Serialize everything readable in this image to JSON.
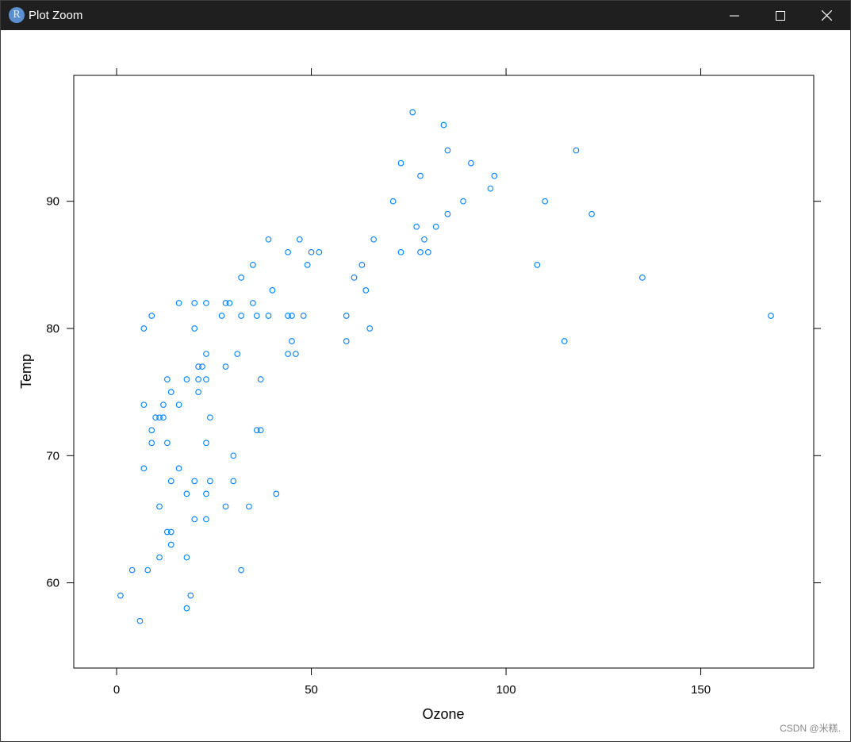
{
  "window": {
    "title": "Plot Zoom",
    "app_icon_letter": "R",
    "controls": {
      "minimize": "minimize",
      "maximize": "maximize",
      "close": "close"
    }
  },
  "watermark": "CSDN @米糕.",
  "chart_data": {
    "type": "scatter",
    "xlabel": "Ozone",
    "ylabel": "Temp",
    "xlim": [
      -11,
      179
    ],
    "ylim": [
      53.3,
      99.9
    ],
    "x_ticks": [
      0,
      50,
      100,
      150
    ],
    "y_ticks": [
      60,
      70,
      80,
      90
    ],
    "grid": false,
    "marker": {
      "shape": "open-circle",
      "color": "#0080ff"
    },
    "points": [
      {
        "x": 1,
        "y": 59
      },
      {
        "x": 4,
        "y": 61
      },
      {
        "x": 6,
        "y": 57
      },
      {
        "x": 7,
        "y": 80
      },
      {
        "x": 7,
        "y": 74
      },
      {
        "x": 7,
        "y": 69
      },
      {
        "x": 8,
        "y": 61
      },
      {
        "x": 9,
        "y": 81
      },
      {
        "x": 9,
        "y": 72
      },
      {
        "x": 9,
        "y": 71
      },
      {
        "x": 10,
        "y": 73
      },
      {
        "x": 11,
        "y": 73
      },
      {
        "x": 11,
        "y": 66
      },
      {
        "x": 11,
        "y": 62
      },
      {
        "x": 12,
        "y": 74
      },
      {
        "x": 12,
        "y": 73
      },
      {
        "x": 13,
        "y": 76
      },
      {
        "x": 13,
        "y": 71
      },
      {
        "x": 13,
        "y": 64
      },
      {
        "x": 14,
        "y": 75
      },
      {
        "x": 14,
        "y": 68
      },
      {
        "x": 14,
        "y": 64
      },
      {
        "x": 14,
        "y": 63
      },
      {
        "x": 16,
        "y": 82
      },
      {
        "x": 16,
        "y": 74
      },
      {
        "x": 16,
        "y": 69
      },
      {
        "x": 18,
        "y": 76
      },
      {
        "x": 18,
        "y": 67
      },
      {
        "x": 18,
        "y": 62
      },
      {
        "x": 18,
        "y": 58
      },
      {
        "x": 19,
        "y": 59
      },
      {
        "x": 20,
        "y": 82
      },
      {
        "x": 20,
        "y": 80
      },
      {
        "x": 20,
        "y": 68
      },
      {
        "x": 20,
        "y": 65
      },
      {
        "x": 21,
        "y": 77
      },
      {
        "x": 21,
        "y": 76
      },
      {
        "x": 21,
        "y": 75
      },
      {
        "x": 22,
        "y": 77
      },
      {
        "x": 23,
        "y": 82
      },
      {
        "x": 23,
        "y": 78
      },
      {
        "x": 23,
        "y": 76
      },
      {
        "x": 23,
        "y": 71
      },
      {
        "x": 23,
        "y": 67
      },
      {
        "x": 23,
        "y": 65
      },
      {
        "x": 24,
        "y": 73
      },
      {
        "x": 24,
        "y": 68
      },
      {
        "x": 27,
        "y": 81
      },
      {
        "x": 28,
        "y": 82
      },
      {
        "x": 28,
        "y": 77
      },
      {
        "x": 28,
        "y": 66
      },
      {
        "x": 29,
        "y": 82
      },
      {
        "x": 30,
        "y": 70
      },
      {
        "x": 30,
        "y": 68
      },
      {
        "x": 31,
        "y": 78
      },
      {
        "x": 32,
        "y": 84
      },
      {
        "x": 32,
        "y": 81
      },
      {
        "x": 32,
        "y": 61
      },
      {
        "x": 34,
        "y": 66
      },
      {
        "x": 35,
        "y": 85
      },
      {
        "x": 35,
        "y": 82
      },
      {
        "x": 36,
        "y": 81
      },
      {
        "x": 36,
        "y": 72
      },
      {
        "x": 37,
        "y": 76
      },
      {
        "x": 37,
        "y": 72
      },
      {
        "x": 39,
        "y": 87
      },
      {
        "x": 39,
        "y": 81
      },
      {
        "x": 40,
        "y": 83
      },
      {
        "x": 41,
        "y": 67
      },
      {
        "x": 44,
        "y": 86
      },
      {
        "x": 44,
        "y": 81
      },
      {
        "x": 44,
        "y": 78
      },
      {
        "x": 45,
        "y": 81
      },
      {
        "x": 45,
        "y": 79
      },
      {
        "x": 46,
        "y": 78
      },
      {
        "x": 47,
        "y": 87
      },
      {
        "x": 48,
        "y": 81
      },
      {
        "x": 49,
        "y": 85
      },
      {
        "x": 50,
        "y": 86
      },
      {
        "x": 52,
        "y": 86
      },
      {
        "x": 59,
        "y": 81
      },
      {
        "x": 59,
        "y": 79
      },
      {
        "x": 61,
        "y": 84
      },
      {
        "x": 63,
        "y": 85
      },
      {
        "x": 64,
        "y": 83
      },
      {
        "x": 65,
        "y": 80
      },
      {
        "x": 66,
        "y": 87
      },
      {
        "x": 71,
        "y": 90
      },
      {
        "x": 73,
        "y": 93
      },
      {
        "x": 73,
        "y": 86
      },
      {
        "x": 76,
        "y": 97
      },
      {
        "x": 77,
        "y": 88
      },
      {
        "x": 78,
        "y": 92
      },
      {
        "x": 78,
        "y": 86
      },
      {
        "x": 79,
        "y": 87
      },
      {
        "x": 80,
        "y": 86
      },
      {
        "x": 82,
        "y": 88
      },
      {
        "x": 84,
        "y": 96
      },
      {
        "x": 85,
        "y": 94
      },
      {
        "x": 85,
        "y": 89
      },
      {
        "x": 89,
        "y": 90
      },
      {
        "x": 91,
        "y": 93
      },
      {
        "x": 96,
        "y": 91
      },
      {
        "x": 97,
        "y": 92
      },
      {
        "x": 108,
        "y": 85
      },
      {
        "x": 110,
        "y": 90
      },
      {
        "x": 115,
        "y": 79
      },
      {
        "x": 118,
        "y": 94
      },
      {
        "x": 122,
        "y": 89
      },
      {
        "x": 135,
        "y": 84
      },
      {
        "x": 168,
        "y": 81
      }
    ]
  }
}
